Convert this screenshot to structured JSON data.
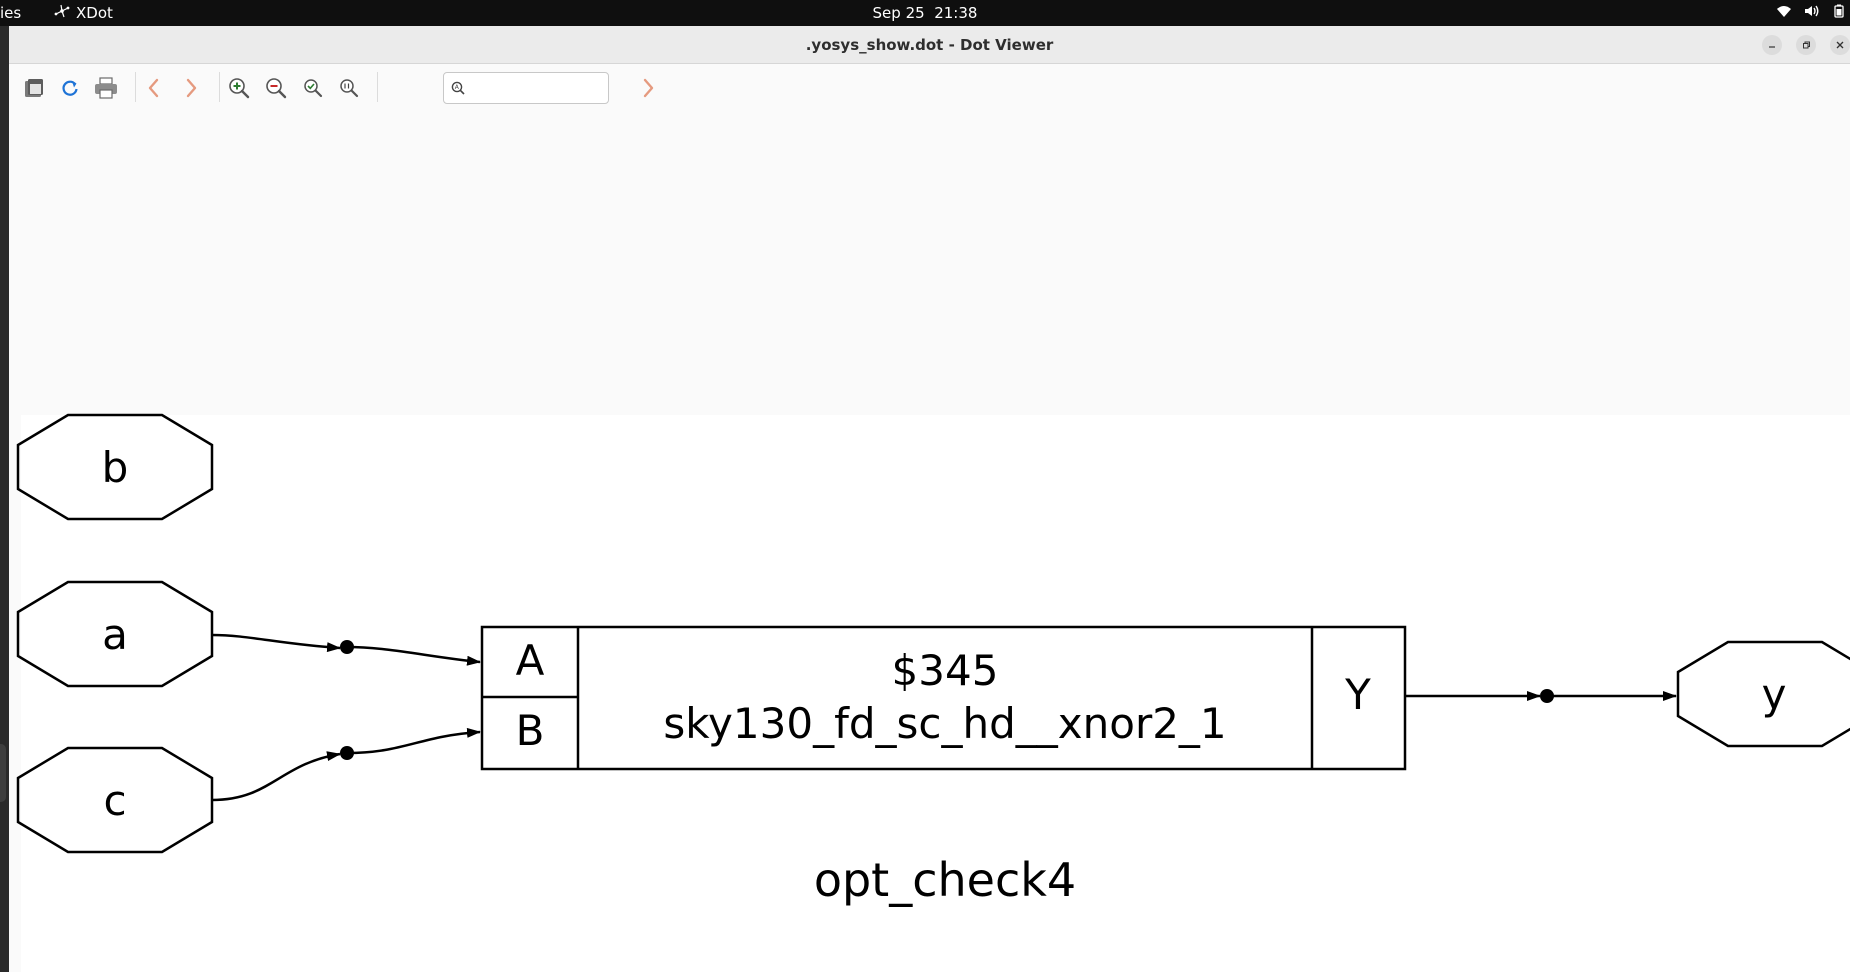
{
  "topbar": {
    "activities_label": "ies",
    "app_name": "XDot",
    "date": "Sep 25",
    "time": "21:38",
    "tray_icons": [
      "wifi-icon",
      "volume-icon",
      "battery-icon"
    ]
  },
  "window": {
    "title": ".yosys_show.dot - Dot Viewer",
    "controls": [
      "minimize",
      "maximize",
      "close"
    ]
  },
  "toolbar": {
    "buttons": [
      "open",
      "reload",
      "print",
      "back",
      "forward",
      "zoom-in",
      "zoom-out",
      "zoom-fit",
      "zoom-100"
    ],
    "find_value": "",
    "find_next_icon": "chevron-right-icon"
  },
  "graph": {
    "inputs": [
      "b",
      "a",
      "c"
    ],
    "output": "y",
    "cell": {
      "id": "$345",
      "type": "sky130_fd_sc_hd__xnor2_1",
      "ports_in": [
        "A",
        "B"
      ],
      "port_out": "Y"
    },
    "edges": [
      {
        "from": "a",
        "to": "$345.A"
      },
      {
        "from": "c",
        "to": "$345.B"
      },
      {
        "from": "$345.Y",
        "to": "y"
      }
    ],
    "label": "opt_check4"
  },
  "colors": {
    "topbar": "#0f0f0f",
    "titlebar": "#ebebeb",
    "toolbar": "#fafafa",
    "graph_bg": "#ffffff",
    "stroke": "#000000",
    "zoom_in": "#2e7d32",
    "zoom_out": "#c62828",
    "nav_arrows": "#e59a7f",
    "reload": "#1e73d6"
  }
}
